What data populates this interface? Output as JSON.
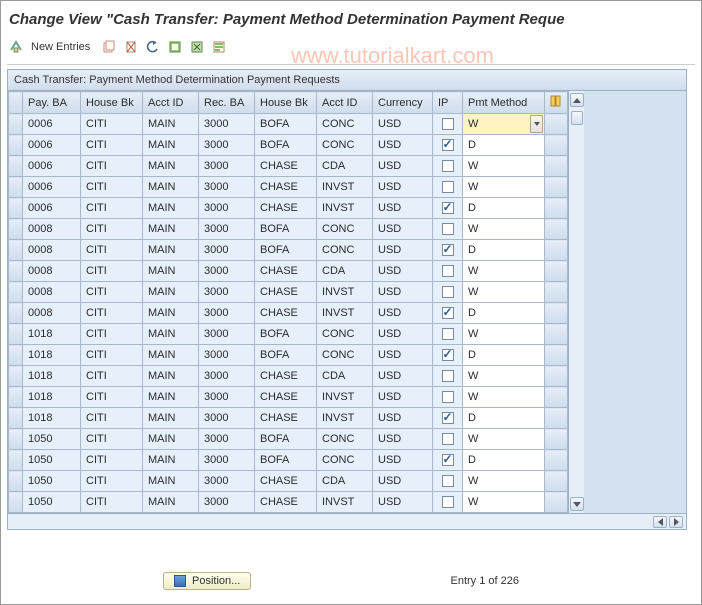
{
  "page_title": "Change View \"Cash Transfer: Payment Method Determination Payment Reque",
  "watermark": "www.tutorialkart.com",
  "toolbar": {
    "new_entries_label": "New Entries"
  },
  "grid": {
    "caption": "Cash Transfer: Payment Method Determination Payment Requests",
    "columns": {
      "pay_ba": "Pay. BA",
      "house_bk": "House Bk",
      "acct_id": "Acct ID",
      "rec_ba": "Rec. BA",
      "house_bk2": "House Bk",
      "acct_id2": "Acct ID",
      "currency": "Currency",
      "ip": "IP",
      "pmt_method": "Pmt Method"
    },
    "rows": [
      {
        "pay_ba": "0006",
        "hbk": "CITI",
        "acct": "MAIN",
        "rec_ba": "3000",
        "hbk2": "BOFA",
        "acct2": "CONC",
        "curr": "USD",
        "ip": false,
        "pm": "W",
        "highlight": true
      },
      {
        "pay_ba": "0006",
        "hbk": "CITI",
        "acct": "MAIN",
        "rec_ba": "3000",
        "hbk2": "BOFA",
        "acct2": "CONC",
        "curr": "USD",
        "ip": true,
        "pm": "D"
      },
      {
        "pay_ba": "0006",
        "hbk": "CITI",
        "acct": "MAIN",
        "rec_ba": "3000",
        "hbk2": "CHASE",
        "acct2": "CDA",
        "curr": "USD",
        "ip": false,
        "pm": "W"
      },
      {
        "pay_ba": "0006",
        "hbk": "CITI",
        "acct": "MAIN",
        "rec_ba": "3000",
        "hbk2": "CHASE",
        "acct2": "INVST",
        "curr": "USD",
        "ip": false,
        "pm": "W"
      },
      {
        "pay_ba": "0006",
        "hbk": "CITI",
        "acct": "MAIN",
        "rec_ba": "3000",
        "hbk2": "CHASE",
        "acct2": "INVST",
        "curr": "USD",
        "ip": true,
        "pm": "D"
      },
      {
        "pay_ba": "0008",
        "hbk": "CITI",
        "acct": "MAIN",
        "rec_ba": "3000",
        "hbk2": "BOFA",
        "acct2": "CONC",
        "curr": "USD",
        "ip": false,
        "pm": "W"
      },
      {
        "pay_ba": "0008",
        "hbk": "CITI",
        "acct": "MAIN",
        "rec_ba": "3000",
        "hbk2": "BOFA",
        "acct2": "CONC",
        "curr": "USD",
        "ip": true,
        "pm": "D"
      },
      {
        "pay_ba": "0008",
        "hbk": "CITI",
        "acct": "MAIN",
        "rec_ba": "3000",
        "hbk2": "CHASE",
        "acct2": "CDA",
        "curr": "USD",
        "ip": false,
        "pm": "W"
      },
      {
        "pay_ba": "0008",
        "hbk": "CITI",
        "acct": "MAIN",
        "rec_ba": "3000",
        "hbk2": "CHASE",
        "acct2": "INVST",
        "curr": "USD",
        "ip": false,
        "pm": "W"
      },
      {
        "pay_ba": "0008",
        "hbk": "CITI",
        "acct": "MAIN",
        "rec_ba": "3000",
        "hbk2": "CHASE",
        "acct2": "INVST",
        "curr": "USD",
        "ip": true,
        "pm": "D"
      },
      {
        "pay_ba": "1018",
        "hbk": "CITI",
        "acct": "MAIN",
        "rec_ba": "3000",
        "hbk2": "BOFA",
        "acct2": "CONC",
        "curr": "USD",
        "ip": false,
        "pm": "W"
      },
      {
        "pay_ba": "1018",
        "hbk": "CITI",
        "acct": "MAIN",
        "rec_ba": "3000",
        "hbk2": "BOFA",
        "acct2": "CONC",
        "curr": "USD",
        "ip": true,
        "pm": "D"
      },
      {
        "pay_ba": "1018",
        "hbk": "CITI",
        "acct": "MAIN",
        "rec_ba": "3000",
        "hbk2": "CHASE",
        "acct2": "CDA",
        "curr": "USD",
        "ip": false,
        "pm": "W"
      },
      {
        "pay_ba": "1018",
        "hbk": "CITI",
        "acct": "MAIN",
        "rec_ba": "3000",
        "hbk2": "CHASE",
        "acct2": "INVST",
        "curr": "USD",
        "ip": false,
        "pm": "W"
      },
      {
        "pay_ba": "1018",
        "hbk": "CITI",
        "acct": "MAIN",
        "rec_ba": "3000",
        "hbk2": "CHASE",
        "acct2": "INVST",
        "curr": "USD",
        "ip": true,
        "pm": "D"
      },
      {
        "pay_ba": "1050",
        "hbk": "CITI",
        "acct": "MAIN",
        "rec_ba": "3000",
        "hbk2": "BOFA",
        "acct2": "CONC",
        "curr": "USD",
        "ip": false,
        "pm": "W"
      },
      {
        "pay_ba": "1050",
        "hbk": "CITI",
        "acct": "MAIN",
        "rec_ba": "3000",
        "hbk2": "BOFA",
        "acct2": "CONC",
        "curr": "USD",
        "ip": true,
        "pm": "D"
      },
      {
        "pay_ba": "1050",
        "hbk": "CITI",
        "acct": "MAIN",
        "rec_ba": "3000",
        "hbk2": "CHASE",
        "acct2": "CDA",
        "curr": "USD",
        "ip": false,
        "pm": "W"
      },
      {
        "pay_ba": "1050",
        "hbk": "CITI",
        "acct": "MAIN",
        "rec_ba": "3000",
        "hbk2": "CHASE",
        "acct2": "INVST",
        "curr": "USD",
        "ip": false,
        "pm": "W"
      }
    ]
  },
  "footer": {
    "position_label": "Position...",
    "entry_info": "Entry 1 of 226"
  }
}
